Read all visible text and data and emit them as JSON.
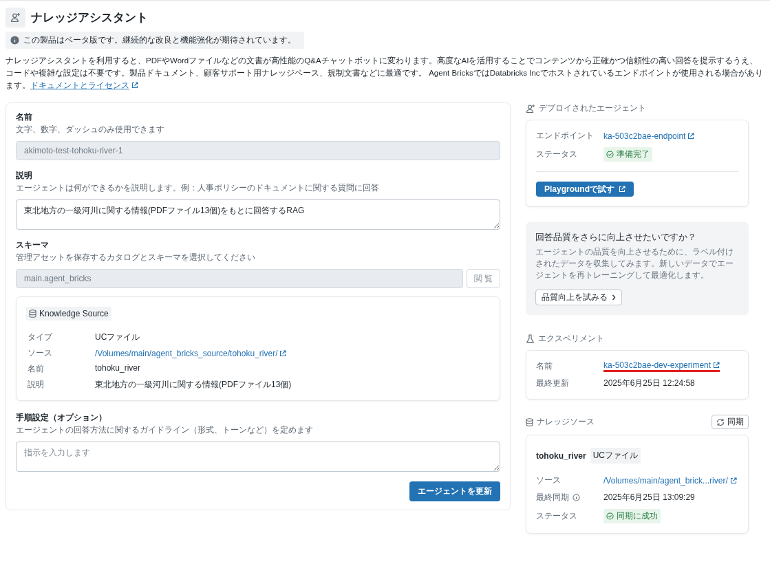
{
  "header": {
    "title": "ナレッジアシスタント"
  },
  "beta_notice": "この製品はベータ版です。継続的な改良と機能強化が期待されています。",
  "intro": {
    "text": "ナレッジアシスタントを利用すると、PDFやWordファイルなどの文書が高性能のQ&Aチャットボットに変わります。高度なAIを活用することでコンテンツから正確かつ信頼性の高い回答を提示するうえ、コードや複雑な設定は不要です。製品ドキュメント、顧客サポート用ナレッジベース、規制文書などに最適です。 Agent BricksではDatabricks Incでホストされているエンドポイントが使用される場合があります。",
    "link": "ドキュメントとライセンス"
  },
  "form": {
    "fields": [
      {
        "kind": "input",
        "label": "名前",
        "hint": "文字、数字、ダッシュのみ使用できます",
        "value": "akimoto-test-tohoku-river-1",
        "disabled": true
      },
      {
        "kind": "textarea",
        "label": "説明",
        "hint": "エージェントは何ができるかを説明します。例：人事ポリシーのドキュメントに関する質問に回答",
        "value": "東北地方の一級河川に関する情報(PDFファイル13個)をもとに回答するRAG",
        "disabled": false
      },
      {
        "kind": "browse",
        "label": "スキーマ",
        "hint": "管理アセットを保存するカタログとスキーマを選択してください",
        "value": "main.agent_bricks",
        "disabled": true,
        "button": "閲 覧"
      }
    ],
    "knowledge_source": {
      "tag": "Knowledge Source",
      "rows": [
        {
          "kind": "text",
          "label": "タイプ",
          "value": "UCファイル"
        },
        {
          "kind": "link",
          "label": "ソース",
          "value": "/Volumes/main/agent_bricks_source/tohoku_river/"
        },
        {
          "kind": "text",
          "label": "名前",
          "value": "tohoku_river"
        },
        {
          "kind": "text",
          "label": "説明",
          "value": "東北地方の一級河川に関する情報(PDFファイル13個)"
        }
      ]
    },
    "instructions": {
      "label": "手順設定（オプション）",
      "hint": "エージェントの回答方法に関するガイドライン（形式、トーンなど）を定めます",
      "placeholder": "指示を入力します"
    },
    "submit": "エージェントを更新"
  },
  "deployed": {
    "title": "デプロイされたエージェント",
    "rows": [
      {
        "kind": "link",
        "label": "エンドポイント",
        "value": "ka-503c2bae-endpoint"
      },
      {
        "kind": "status",
        "label": "ステータス",
        "value": "準備完了"
      }
    ],
    "button": "Playgroundで試す"
  },
  "quality": {
    "title": "回答品質をさらに向上させたいですか？",
    "text": "エージェントの品質を向上させるために、ラベル付けされたデータを収集してみます。新しいデータでエージェントを再トレーニングして最適化します。",
    "button": "品質向上を試みる"
  },
  "experiment": {
    "title": "エクスペリメント",
    "rows": [
      {
        "kind": "link",
        "label": "名前",
        "value": "ka-503c2bae-dev-experiment",
        "highlighted": true
      },
      {
        "kind": "text",
        "label": "最終更新",
        "value": "2025年6月25日 12:24:58"
      }
    ]
  },
  "knowledge": {
    "title": "ナレッジソース",
    "sync_button": "同期",
    "name": "tohoku_river",
    "tag": "UCファイル",
    "rows": [
      {
        "kind": "link",
        "label": "ソース",
        "value": "/Volumes/main/agent_brick...river/"
      },
      {
        "kind": "info",
        "label": "最終同期",
        "value": "2025年6月25日 13:09:29"
      },
      {
        "kind": "status",
        "label": "ステータス",
        "value": "同期に成功"
      }
    ]
  }
}
